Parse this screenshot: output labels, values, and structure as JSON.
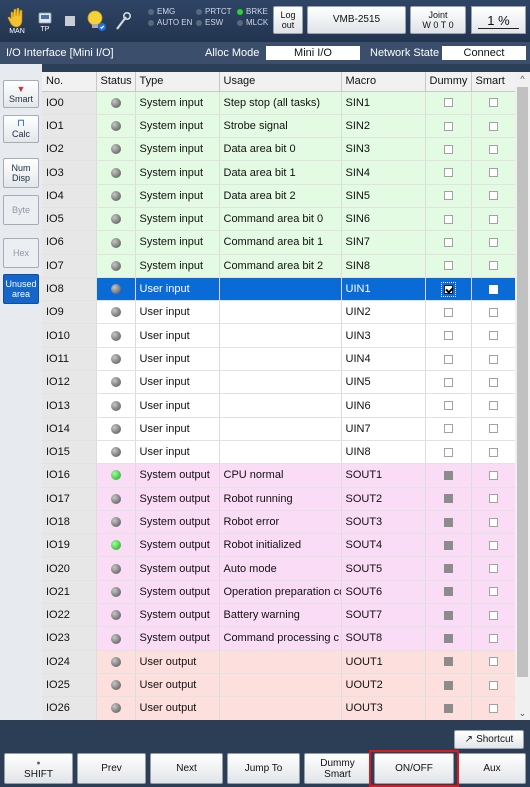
{
  "toolbar": {
    "man_label": "MAN",
    "tp_label": "TP",
    "lamps_left": [
      {
        "label": "EMG",
        "on": false
      },
      {
        "label": "AUTO EN",
        "on": false
      }
    ],
    "lamps_mid": [
      {
        "label": "PRTCT",
        "on": false
      },
      {
        "label": "ESW",
        "on": false
      }
    ],
    "lamps_right": [
      {
        "label": "BRKE",
        "on": true
      },
      {
        "label": "MLCK",
        "on": false
      }
    ],
    "logout_label": "Log\nout",
    "robot_model": "VMB-2515",
    "joint_label": "Joint",
    "joint_value": "W 0 T 0",
    "speed_value": "1 %"
  },
  "info": {
    "title": "I/O Interface [Mini I/O]",
    "alloc_mode_label": "Alloc Mode",
    "alloc_mode_value": "Mini I/O",
    "network_state_label": "Network State",
    "network_state_value": "Connect"
  },
  "side_buttons": [
    {
      "label": "Smart",
      "state": "normal"
    },
    {
      "label": "Calc",
      "state": "normal"
    },
    {
      "label": "Num\nDisp",
      "state": "normal"
    },
    {
      "label": "Byte",
      "state": "disabled"
    },
    {
      "label": "Hex",
      "state": "disabled"
    },
    {
      "label": "Unused\narea",
      "state": "active"
    }
  ],
  "table": {
    "headers": [
      "No.",
      "Status",
      "Type",
      "Usage",
      "Macro",
      "Dummy",
      "Smart"
    ],
    "rows": [
      {
        "no": "IO0",
        "status": "off",
        "type": "System input",
        "usage": "Step stop (all tasks)",
        "macro": "SIN1",
        "dummy": "empty",
        "smart": "empty",
        "color": "green"
      },
      {
        "no": "IO1",
        "status": "off",
        "type": "System input",
        "usage": "Strobe signal",
        "macro": "SIN2",
        "dummy": "empty",
        "smart": "empty",
        "color": "green"
      },
      {
        "no": "IO2",
        "status": "off",
        "type": "System input",
        "usage": "Data area bit 0",
        "macro": "SIN3",
        "dummy": "empty",
        "smart": "empty",
        "color": "green"
      },
      {
        "no": "IO3",
        "status": "off",
        "type": "System input",
        "usage": "Data area bit 1",
        "macro": "SIN4",
        "dummy": "empty",
        "smart": "empty",
        "color": "green"
      },
      {
        "no": "IO4",
        "status": "off",
        "type": "System input",
        "usage": "Data area bit 2",
        "macro": "SIN5",
        "dummy": "empty",
        "smart": "empty",
        "color": "green"
      },
      {
        "no": "IO5",
        "status": "off",
        "type": "System input",
        "usage": "Command area  bit 0",
        "macro": "SIN6",
        "dummy": "empty",
        "smart": "empty",
        "color": "green"
      },
      {
        "no": "IO6",
        "status": "off",
        "type": "System input",
        "usage": "Command area  bit 1",
        "macro": "SIN7",
        "dummy": "empty",
        "smart": "empty",
        "color": "green"
      },
      {
        "no": "IO7",
        "status": "off",
        "type": "System input",
        "usage": "Command area  bit 2",
        "macro": "SIN8",
        "dummy": "empty",
        "smart": "empty",
        "color": "green"
      },
      {
        "no": "IO8",
        "status": "off",
        "type": "User input",
        "usage": "",
        "macro": "UIN1",
        "dummy": "checked",
        "smart": "white",
        "color": "sel"
      },
      {
        "no": "IO9",
        "status": "off",
        "type": "User input",
        "usage": "",
        "macro": "UIN2",
        "dummy": "empty",
        "smart": "empty",
        "color": "user"
      },
      {
        "no": "IO10",
        "status": "off",
        "type": "User input",
        "usage": "",
        "macro": "UIN3",
        "dummy": "empty",
        "smart": "empty",
        "color": "user"
      },
      {
        "no": "IO11",
        "status": "off",
        "type": "User input",
        "usage": "",
        "macro": "UIN4",
        "dummy": "empty",
        "smart": "empty",
        "color": "user"
      },
      {
        "no": "IO12",
        "status": "off",
        "type": "User input",
        "usage": "",
        "macro": "UIN5",
        "dummy": "empty",
        "smart": "empty",
        "color": "user"
      },
      {
        "no": "IO13",
        "status": "off",
        "type": "User input",
        "usage": "",
        "macro": "UIN6",
        "dummy": "empty",
        "smart": "empty",
        "color": "user"
      },
      {
        "no": "IO14",
        "status": "off",
        "type": "User input",
        "usage": "",
        "macro": "UIN7",
        "dummy": "empty",
        "smart": "empty",
        "color": "user"
      },
      {
        "no": "IO15",
        "status": "off",
        "type": "User input",
        "usage": "",
        "macro": "UIN8",
        "dummy": "empty",
        "smart": "empty",
        "color": "user"
      },
      {
        "no": "IO16",
        "status": "on",
        "type": "System output",
        "usage": "CPU normal",
        "macro": "SOUT1",
        "dummy": "filled",
        "smart": "empty",
        "color": "pink"
      },
      {
        "no": "IO17",
        "status": "off",
        "type": "System output",
        "usage": "Robot running",
        "macro": "SOUT2",
        "dummy": "filled",
        "smart": "empty",
        "color": "pink"
      },
      {
        "no": "IO18",
        "status": "off",
        "type": "System output",
        "usage": "Robot error",
        "macro": "SOUT3",
        "dummy": "filled",
        "smart": "empty",
        "color": "pink"
      },
      {
        "no": "IO19",
        "status": "on",
        "type": "System output",
        "usage": "Robot initialized",
        "macro": "SOUT4",
        "dummy": "filled",
        "smart": "empty",
        "color": "pink"
      },
      {
        "no": "IO20",
        "status": "off",
        "type": "System output",
        "usage": "Auto mode",
        "macro": "SOUT5",
        "dummy": "filled",
        "smart": "empty",
        "color": "pink"
      },
      {
        "no": "IO21",
        "status": "off",
        "type": "System output",
        "usage": "Operation preparation cc",
        "macro": "SOUT6",
        "dummy": "filled",
        "smart": "empty",
        "color": "pink"
      },
      {
        "no": "IO22",
        "status": "off",
        "type": "System output",
        "usage": "Battery warning",
        "macro": "SOUT7",
        "dummy": "filled",
        "smart": "empty",
        "color": "pink"
      },
      {
        "no": "IO23",
        "status": "off",
        "type": "System output",
        "usage": "Command processing c",
        "macro": "SOUT8",
        "dummy": "filled",
        "smart": "empty",
        "color": "pink"
      },
      {
        "no": "IO24",
        "status": "off",
        "type": "User output",
        "usage": "",
        "macro": "UOUT1",
        "dummy": "filled",
        "smart": "empty",
        "color": "salmon"
      },
      {
        "no": "IO25",
        "status": "off",
        "type": "User output",
        "usage": "",
        "macro": "UOUT2",
        "dummy": "filled",
        "smart": "empty",
        "color": "salmon"
      },
      {
        "no": "IO26",
        "status": "off",
        "type": "User output",
        "usage": "",
        "macro": "UOUT3",
        "dummy": "filled",
        "smart": "empty",
        "color": "salmon"
      }
    ]
  },
  "shortcut_label": "Shortcut",
  "function_buttons": [
    {
      "name": "shift-button",
      "label": "SHIFT"
    },
    {
      "name": "prev-button",
      "label": "Prev"
    },
    {
      "name": "next-button",
      "label": "Next"
    },
    {
      "name": "jump-to-button",
      "label": "Jump To"
    },
    {
      "name": "dummy-smart-button",
      "label": "Dummy\nSmart"
    },
    {
      "name": "on-off-button",
      "label": "ON/OFF"
    },
    {
      "name": "aux-button",
      "label": "Aux"
    }
  ],
  "colors": {
    "selection": "#0a6ad6",
    "system_input_row": "#e3fbe3",
    "system_output_row": "#fbdcf6",
    "user_output_row": "#fde0de",
    "led_on": "#17a317",
    "highlight_box": "#e0181d"
  }
}
